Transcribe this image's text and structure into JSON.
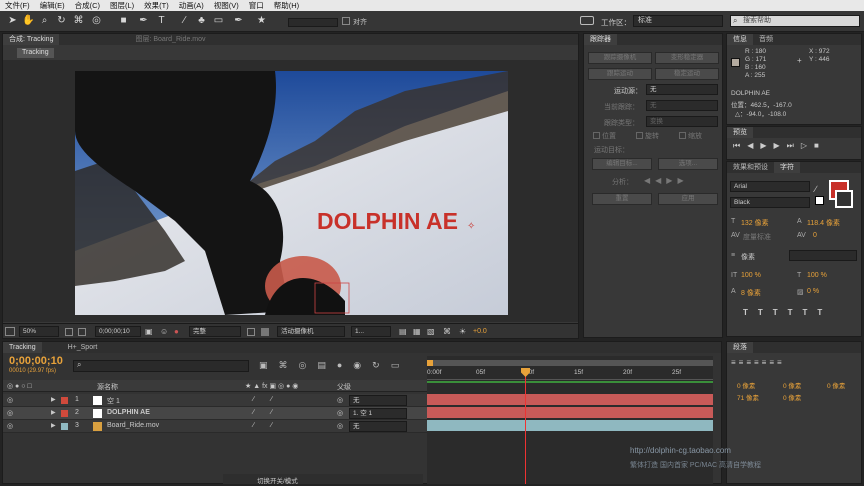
{
  "menu": [
    "文件(F)",
    "编辑(E)",
    "合成(C)",
    "图层(L)",
    "效果(T)",
    "动画(A)",
    "视图(V)",
    "窗口",
    "帮助(H)"
  ],
  "toolbar": {
    "align_label": "对齐",
    "workspace_label": "工作区：",
    "workspace_value": "标准",
    "search_placeholder": "搜索帮助"
  },
  "comp_panel": {
    "tab_comp": "合成: Tracking",
    "tab_layer": "图层: Board_Ride.mov",
    "breadcrumb": "Tracking",
    "overlay_text": "DOLPHIN AE",
    "zoom": "50%",
    "timecode": "0;00;00;10",
    "resolution": "完整",
    "camera": "活动摄像机",
    "views": "1...",
    "exposure": "+0.0"
  },
  "tracker": {
    "title": "跟踪器",
    "btn_track_camera": "跟踪摄像机",
    "btn_warp_stabilizer": "变形稳定器",
    "btn_track_motion": "跟踪运动",
    "btn_stabilize_motion": "稳定运动",
    "motion_source_label": "运动源：",
    "motion_source_value": "无",
    "current_track_label": "当前跟踪：",
    "current_track_value": "无",
    "track_type_label": "跟踪类型：",
    "track_type_value": "变换",
    "chk_position": "位置",
    "chk_rotation": "旋转",
    "chk_scale": "缩放",
    "motion_target_label": "运动目标：",
    "btn_edit_target": "编辑目标...",
    "btn_options": "选项...",
    "analyze_label": "分析：",
    "btn_reset": "重置",
    "btn_apply": "应用"
  },
  "info": {
    "tab_info": "信息",
    "tab_audio": "音频",
    "r": "R : 180",
    "g": "G : 171",
    "b": "B : 160",
    "a": "A : 255",
    "x": "X : 972",
    "y": "Y : 446",
    "color_hex": "#b4aba0",
    "layer_name": "DOLPHIN AE",
    "position": "位置：462.5，-167.0",
    "delta": "△：-94.0，-108.0"
  },
  "preview": {
    "title": "预览"
  },
  "effects": {
    "tab_effects": "效果和预设",
    "tab_character": "字符"
  },
  "character": {
    "font": "Arial",
    "style": "Black",
    "size": "132 像素",
    "leading": "118.4 像素",
    "kerning": "度量标准",
    "tracking": "0",
    "stroke": "像素",
    "stroke_type": "",
    "vert_scale": "100 %",
    "horiz_scale": "100 %",
    "baseline": "8 像素",
    "tsume": "0 %",
    "fill_color": "#c8312a"
  },
  "paragraph": {
    "title": "段落",
    "indent1": "0 像素",
    "indent2": "0 像素",
    "indent3": "0 像素",
    "space1": "0 像素",
    "space2": "0 像素",
    "space3": "71 像素"
  },
  "timeline": {
    "tab_tracking": "Tracking",
    "tab_sport": "H+_Sport",
    "timecode": "0;00;00;10",
    "frame_info": "00010 (29.97 fps)",
    "col_name": "源名称",
    "col_parent": "父级",
    "switch_label": "切换开关/模式",
    "ruler": [
      "0:00f",
      "05f",
      "10f",
      "15f",
      "20f",
      "25f"
    ],
    "layers": [
      {
        "index": "1",
        "name": "空 1",
        "color": "#d04a3c",
        "parent": "无"
      },
      {
        "index": "2",
        "name": "DOLPHIN AE",
        "color": "#d04a3c",
        "parent": "1. 空 1"
      },
      {
        "index": "3",
        "name": "Board_Ride.mov",
        "color": "#8fb8c0",
        "parent": "无"
      }
    ]
  },
  "watermark": {
    "url": "http://dolphin-cg.taobao.com",
    "line2": "繁体打造 国内首家 PC/MAC 高清自学教程"
  }
}
